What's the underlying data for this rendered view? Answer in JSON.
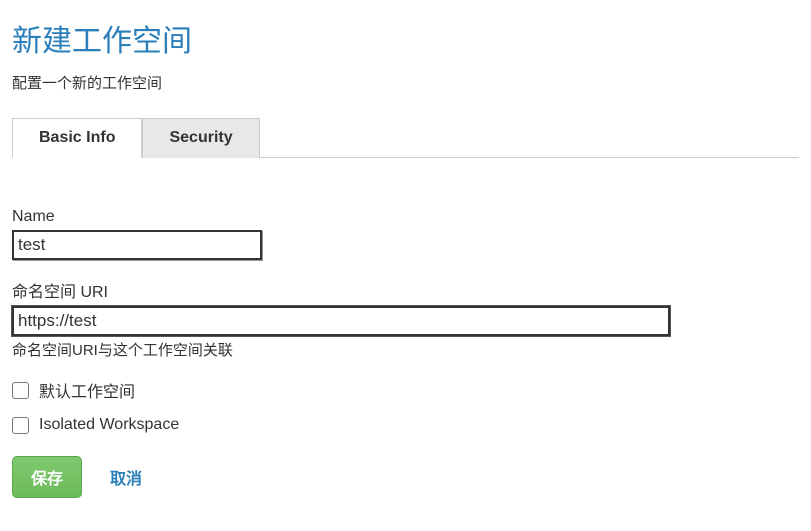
{
  "header": {
    "title": "新建工作空间",
    "subtitle": "配置一个新的工作空间"
  },
  "tabs": {
    "basic_info": "Basic Info",
    "security": "Security"
  },
  "form": {
    "name": {
      "label": "Name",
      "value": "test"
    },
    "uri": {
      "label": "命名空间 URI",
      "value": "https://test",
      "help": "命名空间URI与这个工作空间关联"
    },
    "default_workspace": {
      "label": "默认工作空间",
      "checked": false
    },
    "isolated_workspace": {
      "label": "Isolated Workspace",
      "checked": false
    }
  },
  "buttons": {
    "save": "保存",
    "cancel": "取消"
  }
}
